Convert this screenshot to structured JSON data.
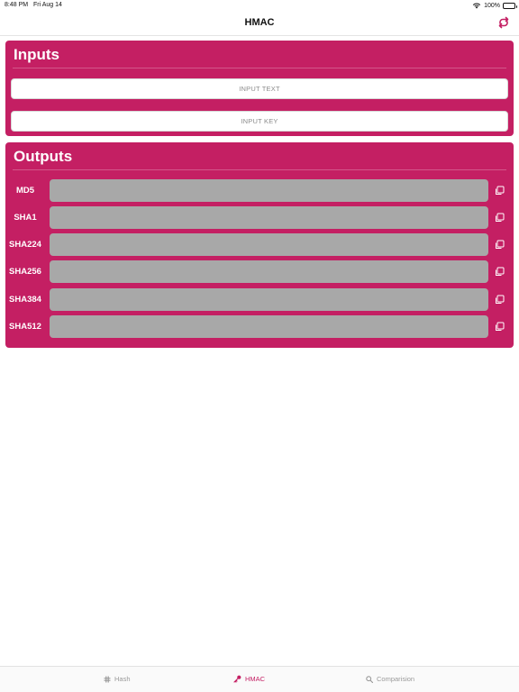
{
  "status_bar": {
    "time": "8:48 PM",
    "date": "Fri Aug 14",
    "battery": "100%"
  },
  "nav": {
    "title": "HMAC",
    "action_icon": "swap-arrows-icon"
  },
  "inputs": {
    "title": "Inputs",
    "text_placeholder": "INPUT TEXT",
    "key_placeholder": "INPUT KEY"
  },
  "outputs": {
    "title": "Outputs",
    "rows": [
      {
        "label": "MD5"
      },
      {
        "label": "SHA1"
      },
      {
        "label": "SHA224"
      },
      {
        "label": "SHA256"
      },
      {
        "label": "SHA384"
      },
      {
        "label": "SHA512"
      }
    ]
  },
  "tabs": [
    {
      "label": "Hash",
      "icon": "hash-icon",
      "selected": false
    },
    {
      "label": "HMAC",
      "icon": "key-icon",
      "selected": true
    },
    {
      "label": "Comparision",
      "icon": "magnifier-icon",
      "selected": false
    }
  ],
  "colors": {
    "accent": "#c41f63",
    "output_field": "#a8a8a8",
    "tab_inactive": "#9a9a9a"
  }
}
